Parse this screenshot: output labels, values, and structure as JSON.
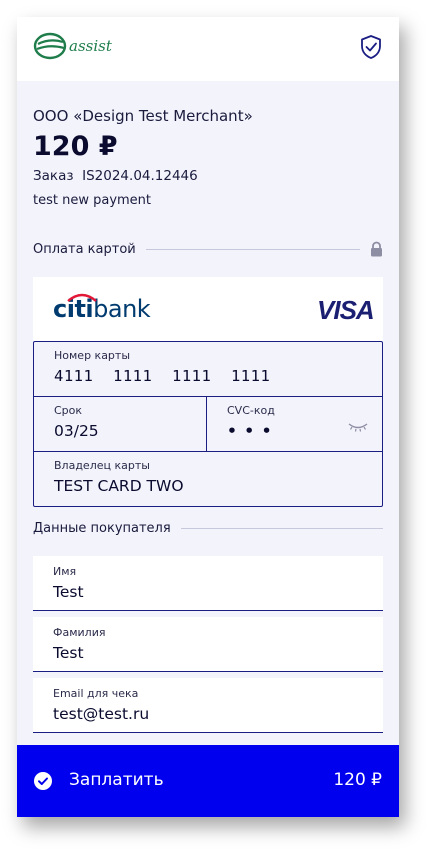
{
  "header": {
    "logo_text": "assist",
    "logo_icon": "assist-logo-icon",
    "shield_icon": "shield-check-icon"
  },
  "order": {
    "merchant": "ООО «Design Test Merchant»",
    "amount": "120 ₽",
    "number": "Заказ  IS2024.04.12446",
    "description": "test new payment"
  },
  "card_section": {
    "title": "Оплата картой",
    "lock_icon": "lock-icon",
    "bank_part1": "citi",
    "bank_part2": "bank",
    "network": "VISA",
    "number_label": "Номер карты",
    "number_value": "4111  1111  1111  1111",
    "expiry_label": "Срок",
    "expiry_value": "03/25",
    "cvc_label": "CVC-код",
    "cvc_value": "• • •",
    "eye_icon": "eye-closed-icon",
    "holder_label": "Владелец карты",
    "holder_value": "TEST CARD TWO"
  },
  "buyer_section": {
    "title": "Данные покупателя",
    "fields": [
      {
        "label": "Имя",
        "value": "Test"
      },
      {
        "label": "Фамилия",
        "value": "Test"
      },
      {
        "label": "Email для чека",
        "value": "test@test.ru"
      }
    ]
  },
  "pay_button": {
    "label": "Заплатить",
    "amount": "120 ₽",
    "icon": "check-circle-icon"
  },
  "colors": {
    "accent": "#0000EE",
    "border": "#1A1D82",
    "background": "#F3F3FB",
    "logo_green": "#1E7D4A"
  }
}
